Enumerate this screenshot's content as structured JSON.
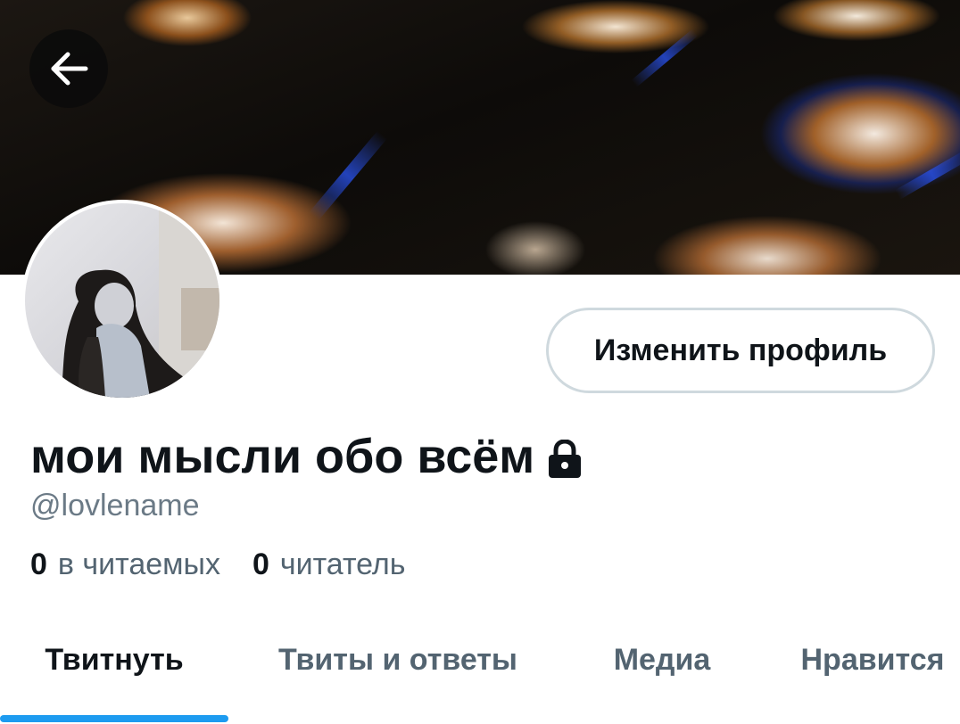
{
  "header": {
    "back_icon": "arrow-left-icon"
  },
  "profile": {
    "edit_button_label": "Изменить профиль",
    "display_name": "мои мысли обо всём",
    "lock_icon": "lock-icon",
    "handle": "@lovlename",
    "following_count": "0",
    "following_label": "в читаемых",
    "followers_count": "0",
    "followers_label": "читатель"
  },
  "tabs": [
    {
      "label": "Твитнуть",
      "active": true
    },
    {
      "label": "Твиты и ответы",
      "active": false
    },
    {
      "label": "Медиа",
      "active": false
    },
    {
      "label": "Нравится",
      "active": false
    }
  ],
  "colors": {
    "accent": "#1d9bf0",
    "text_primary": "#0f1419",
    "text_secondary": "#536471",
    "border": "#cfd9de"
  }
}
